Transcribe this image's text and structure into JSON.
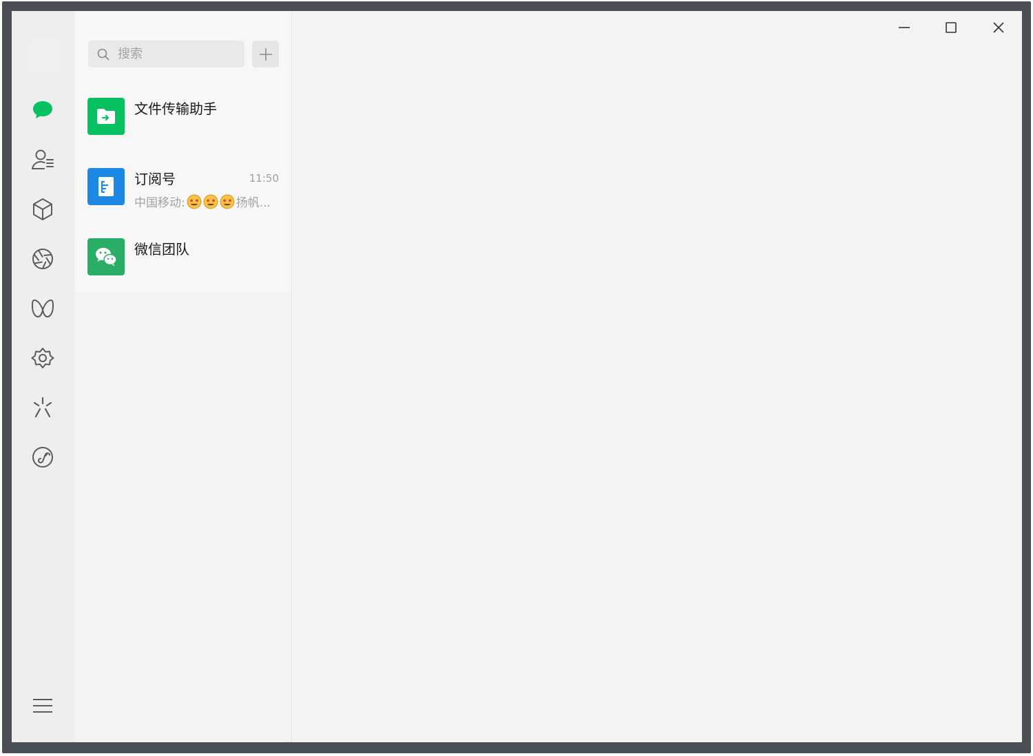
{
  "app": {
    "accent_color": "#07c160",
    "icon_color": "#5b5b5b"
  },
  "rail": {
    "items": [
      {
        "icon": "chat-bubble-icon",
        "active": true
      },
      {
        "icon": "contacts-icon"
      },
      {
        "icon": "favorites-cube-icon"
      },
      {
        "icon": "moments-aperture-icon"
      },
      {
        "icon": "channels-butterfly-icon"
      },
      {
        "icon": "miniprogram-star-icon"
      },
      {
        "icon": "search-sparkle-icon"
      },
      {
        "icon": "miniprogram-link-icon"
      }
    ],
    "menu_icon": "menu-icon"
  },
  "search": {
    "placeholder": "搜索",
    "icon": "search-icon",
    "add_icon": "plus-icon"
  },
  "chats": [
    {
      "name": "文件传输助手",
      "time": "",
      "preview": "",
      "avatar_color": "#07c160",
      "avatar_icon": "file-transfer-icon"
    },
    {
      "name": "订阅号",
      "time": "11:50",
      "preview_prefix": "中国移动: ",
      "preview_suffix": "扬帆...",
      "emoji_count": 3,
      "avatar_color": "#1e88e5",
      "avatar_icon": "subscription-icon"
    },
    {
      "name": "微信团队",
      "time": "",
      "preview": "",
      "avatar_color": "#2aae67",
      "avatar_icon": "wechat-team-icon"
    }
  ],
  "window_controls": {
    "minimize_icon": "minimize-icon",
    "maximize_icon": "maximize-icon",
    "close_icon": "close-icon"
  }
}
